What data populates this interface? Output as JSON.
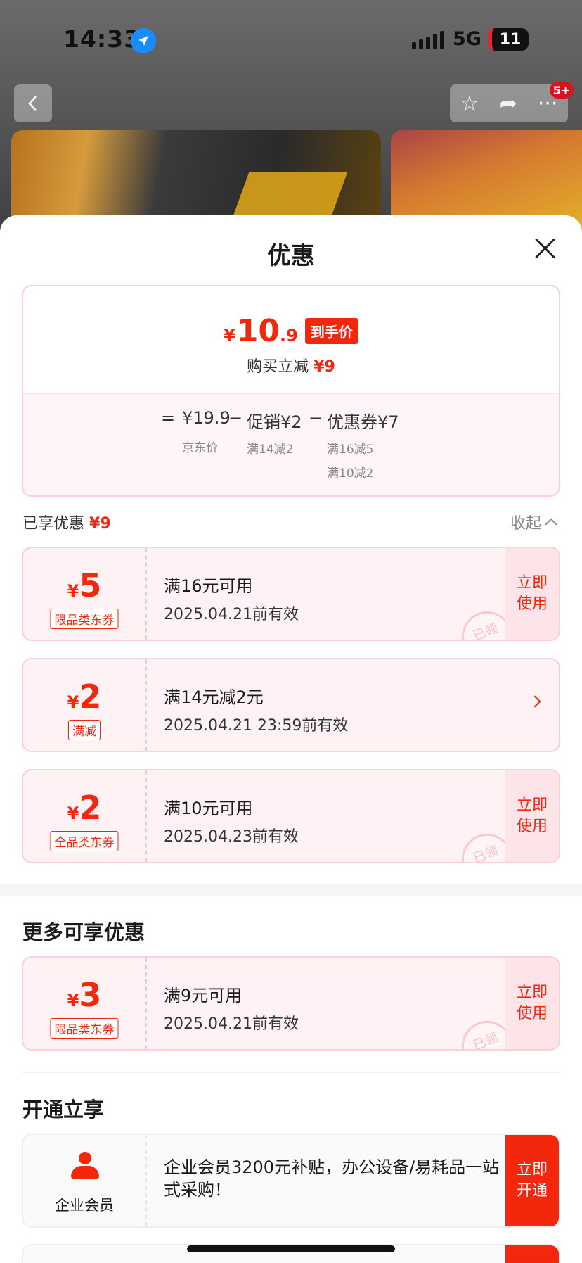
{
  "status_bar": {
    "time": "14:33",
    "network": "5G",
    "battery": "11"
  },
  "header": {
    "notification_badge": "5+"
  },
  "sheet": {
    "title": "优惠",
    "price": {
      "currency": "¥",
      "integer": "10",
      "decimal": ".9",
      "tag": "到手价",
      "reduce_label": "购买立减",
      "reduce_value": "¥9"
    },
    "formula": {
      "equals": "=",
      "base_value": "¥19.9",
      "base_label": "京东价",
      "minus1": "−",
      "promo_value": "促销¥2",
      "promo_detail": "满14减2",
      "minus2": "−",
      "coupon_value": "优惠券¥7",
      "coupon_detail_1": "满16减5",
      "coupon_detail_2": "满10减2"
    },
    "enjoyed": {
      "label": "已享优惠",
      "value": "¥9",
      "collapse": "收起"
    },
    "coupons": [
      {
        "currency": "¥",
        "amount": "5",
        "tag": "限品类东券",
        "title": "满16元可用",
        "date": "2025.04.21前有效",
        "action": "立即使用",
        "stamp": "已领"
      },
      {
        "currency": "¥",
        "amount": "2",
        "tag": "满减",
        "title": "满14元减2元",
        "date": "2025.04.21 23:59前有效"
      },
      {
        "currency": "¥",
        "amount": "2",
        "tag": "全品类东券",
        "title": "满10元可用",
        "date": "2025.04.23前有效",
        "action": "立即使用",
        "stamp": "已领"
      }
    ],
    "more_title": "更多可享优惠",
    "more_coupons": [
      {
        "currency": "¥",
        "amount": "3",
        "tag": "限品类东券",
        "title": "满9元可用",
        "date": "2025.04.21前有效",
        "action": "立即使用",
        "stamp": "已领"
      }
    ],
    "open_title": "开通立享",
    "vip": {
      "name": "企业会员",
      "text": "企业会员3200元补贴，办公设备/易耗品一站式采购！",
      "action": "立即开通"
    }
  },
  "colors": {
    "accent": "#f2270c",
    "coupon_bg": "#fff2f4",
    "coupon_border": "#fbd0d6"
  }
}
